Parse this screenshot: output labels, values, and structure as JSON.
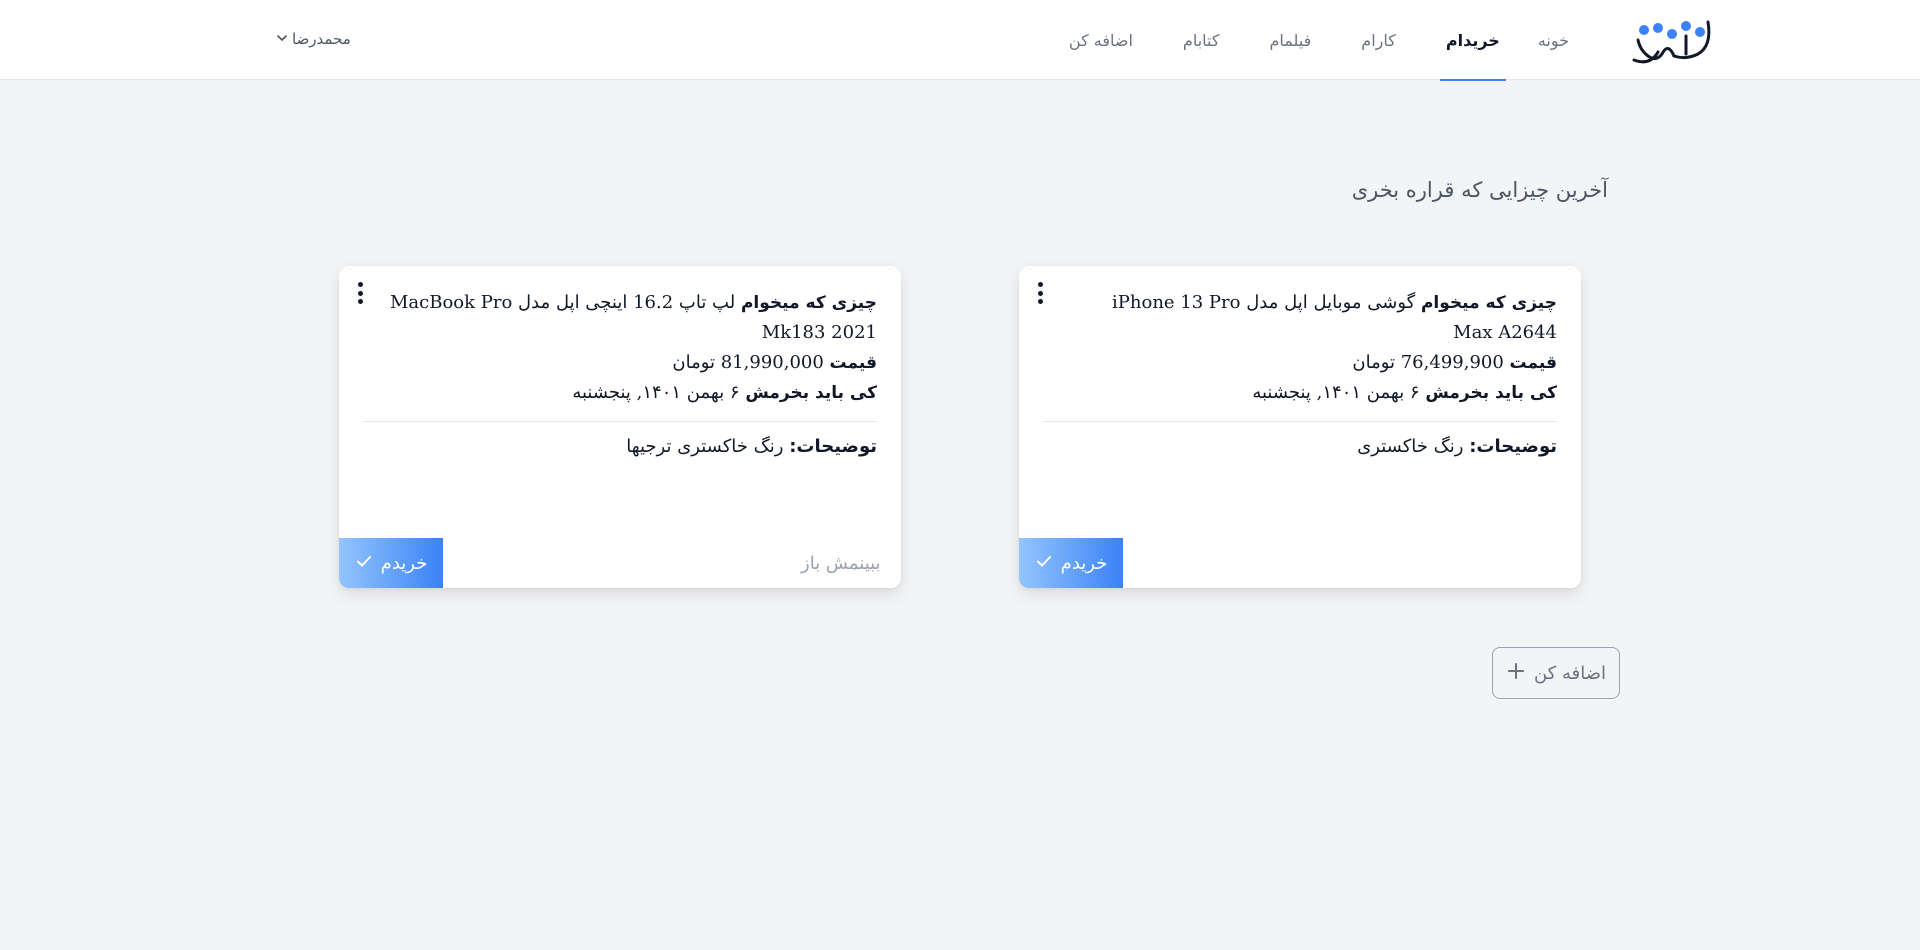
{
  "header": {
    "logo_text": "ویشام",
    "nav": [
      {
        "label": "خونه",
        "active": false
      },
      {
        "label": "خریدام",
        "active": true
      },
      {
        "label": "کارام",
        "active": false
      },
      {
        "label": "فیلمام",
        "active": false
      },
      {
        "label": "کتابام",
        "active": false
      },
      {
        "label": "اضافه کن",
        "active": false
      }
    ],
    "user_name": "محمدرضا"
  },
  "main": {
    "section_title": "آخرین چیزایی که قراره بخری",
    "labels": {
      "item": "چیزی که میخوام",
      "price": "قیمت",
      "when": "کی باید بخرمش",
      "desc": "توضیحات:"
    },
    "cards": [
      {
        "item_name": "گوشی موبایل اپل مدل iPhone 13 Pro Max A2644",
        "price_value": "76,499,900 تومان",
        "date": "۶ بهمن ۱۴۰۱, پنجشنبه",
        "description": "رنگ خاکستری",
        "bought_label": "خریدم",
        "view_label": ""
      },
      {
        "item_name": "لپ تاپ 16.2 اینچی اپل مدل MacBook Pro Mk183 2021",
        "price_value": "81,990,000 تومان",
        "date": "۶ بهمن ۱۴۰۱, پنجشنبه",
        "description": "رنگ خاکستری ترجیها",
        "bought_label": "خریدم",
        "view_label": "ببینمش باز"
      }
    ],
    "add_button_label": "اضافه کن"
  },
  "colors": {
    "accent": "#3b82f6",
    "background": "#f3f4f6",
    "card": "#ffffff"
  },
  "icons": {
    "logo": "wishlist-logo",
    "user_dropdown": "chevron-down-icon",
    "card_menu": "kebab-menu-icon",
    "bought": "check-icon",
    "add": "plus-icon"
  }
}
